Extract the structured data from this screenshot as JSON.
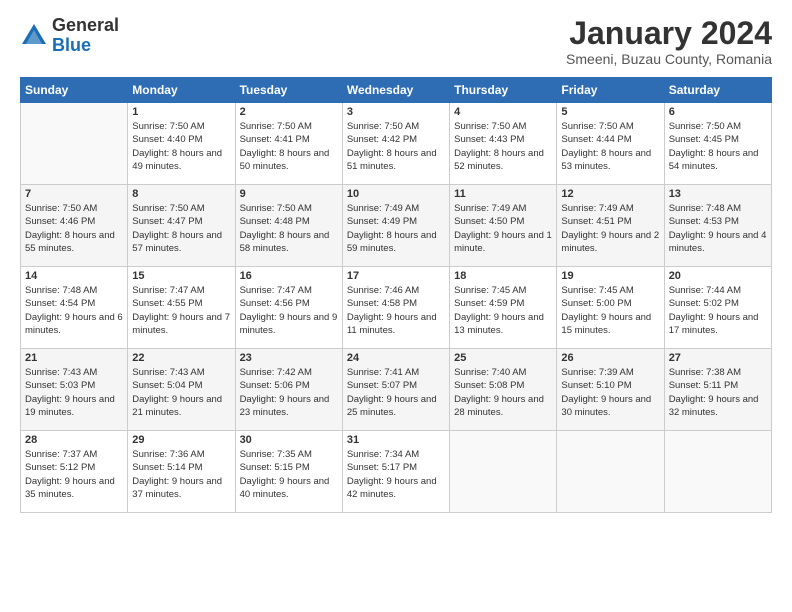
{
  "logo": {
    "general": "General",
    "blue": "Blue"
  },
  "title": "January 2024",
  "location": "Smeeni, Buzau County, Romania",
  "headers": [
    "Sunday",
    "Monday",
    "Tuesday",
    "Wednesday",
    "Thursday",
    "Friday",
    "Saturday"
  ],
  "weeks": [
    [
      {
        "day": "",
        "sunrise": "",
        "sunset": "",
        "daylight": ""
      },
      {
        "day": "1",
        "sunrise": "Sunrise: 7:50 AM",
        "sunset": "Sunset: 4:40 PM",
        "daylight": "Daylight: 8 hours and 49 minutes."
      },
      {
        "day": "2",
        "sunrise": "Sunrise: 7:50 AM",
        "sunset": "Sunset: 4:41 PM",
        "daylight": "Daylight: 8 hours and 50 minutes."
      },
      {
        "day": "3",
        "sunrise": "Sunrise: 7:50 AM",
        "sunset": "Sunset: 4:42 PM",
        "daylight": "Daylight: 8 hours and 51 minutes."
      },
      {
        "day": "4",
        "sunrise": "Sunrise: 7:50 AM",
        "sunset": "Sunset: 4:43 PM",
        "daylight": "Daylight: 8 hours and 52 minutes."
      },
      {
        "day": "5",
        "sunrise": "Sunrise: 7:50 AM",
        "sunset": "Sunset: 4:44 PM",
        "daylight": "Daylight: 8 hours and 53 minutes."
      },
      {
        "day": "6",
        "sunrise": "Sunrise: 7:50 AM",
        "sunset": "Sunset: 4:45 PM",
        "daylight": "Daylight: 8 hours and 54 minutes."
      }
    ],
    [
      {
        "day": "7",
        "sunrise": "Sunrise: 7:50 AM",
        "sunset": "Sunset: 4:46 PM",
        "daylight": "Daylight: 8 hours and 55 minutes."
      },
      {
        "day": "8",
        "sunrise": "Sunrise: 7:50 AM",
        "sunset": "Sunset: 4:47 PM",
        "daylight": "Daylight: 8 hours and 57 minutes."
      },
      {
        "day": "9",
        "sunrise": "Sunrise: 7:50 AM",
        "sunset": "Sunset: 4:48 PM",
        "daylight": "Daylight: 8 hours and 58 minutes."
      },
      {
        "day": "10",
        "sunrise": "Sunrise: 7:49 AM",
        "sunset": "Sunset: 4:49 PM",
        "daylight": "Daylight: 8 hours and 59 minutes."
      },
      {
        "day": "11",
        "sunrise": "Sunrise: 7:49 AM",
        "sunset": "Sunset: 4:50 PM",
        "daylight": "Daylight: 9 hours and 1 minute."
      },
      {
        "day": "12",
        "sunrise": "Sunrise: 7:49 AM",
        "sunset": "Sunset: 4:51 PM",
        "daylight": "Daylight: 9 hours and 2 minutes."
      },
      {
        "day": "13",
        "sunrise": "Sunrise: 7:48 AM",
        "sunset": "Sunset: 4:53 PM",
        "daylight": "Daylight: 9 hours and 4 minutes."
      }
    ],
    [
      {
        "day": "14",
        "sunrise": "Sunrise: 7:48 AM",
        "sunset": "Sunset: 4:54 PM",
        "daylight": "Daylight: 9 hours and 6 minutes."
      },
      {
        "day": "15",
        "sunrise": "Sunrise: 7:47 AM",
        "sunset": "Sunset: 4:55 PM",
        "daylight": "Daylight: 9 hours and 7 minutes."
      },
      {
        "day": "16",
        "sunrise": "Sunrise: 7:47 AM",
        "sunset": "Sunset: 4:56 PM",
        "daylight": "Daylight: 9 hours and 9 minutes."
      },
      {
        "day": "17",
        "sunrise": "Sunrise: 7:46 AM",
        "sunset": "Sunset: 4:58 PM",
        "daylight": "Daylight: 9 hours and 11 minutes."
      },
      {
        "day": "18",
        "sunrise": "Sunrise: 7:45 AM",
        "sunset": "Sunset: 4:59 PM",
        "daylight": "Daylight: 9 hours and 13 minutes."
      },
      {
        "day": "19",
        "sunrise": "Sunrise: 7:45 AM",
        "sunset": "Sunset: 5:00 PM",
        "daylight": "Daylight: 9 hours and 15 minutes."
      },
      {
        "day": "20",
        "sunrise": "Sunrise: 7:44 AM",
        "sunset": "Sunset: 5:02 PM",
        "daylight": "Daylight: 9 hours and 17 minutes."
      }
    ],
    [
      {
        "day": "21",
        "sunrise": "Sunrise: 7:43 AM",
        "sunset": "Sunset: 5:03 PM",
        "daylight": "Daylight: 9 hours and 19 minutes."
      },
      {
        "day": "22",
        "sunrise": "Sunrise: 7:43 AM",
        "sunset": "Sunset: 5:04 PM",
        "daylight": "Daylight: 9 hours and 21 minutes."
      },
      {
        "day": "23",
        "sunrise": "Sunrise: 7:42 AM",
        "sunset": "Sunset: 5:06 PM",
        "daylight": "Daylight: 9 hours and 23 minutes."
      },
      {
        "day": "24",
        "sunrise": "Sunrise: 7:41 AM",
        "sunset": "Sunset: 5:07 PM",
        "daylight": "Daylight: 9 hours and 25 minutes."
      },
      {
        "day": "25",
        "sunrise": "Sunrise: 7:40 AM",
        "sunset": "Sunset: 5:08 PM",
        "daylight": "Daylight: 9 hours and 28 minutes."
      },
      {
        "day": "26",
        "sunrise": "Sunrise: 7:39 AM",
        "sunset": "Sunset: 5:10 PM",
        "daylight": "Daylight: 9 hours and 30 minutes."
      },
      {
        "day": "27",
        "sunrise": "Sunrise: 7:38 AM",
        "sunset": "Sunset: 5:11 PM",
        "daylight": "Daylight: 9 hours and 32 minutes."
      }
    ],
    [
      {
        "day": "28",
        "sunrise": "Sunrise: 7:37 AM",
        "sunset": "Sunset: 5:12 PM",
        "daylight": "Daylight: 9 hours and 35 minutes."
      },
      {
        "day": "29",
        "sunrise": "Sunrise: 7:36 AM",
        "sunset": "Sunset: 5:14 PM",
        "daylight": "Daylight: 9 hours and 37 minutes."
      },
      {
        "day": "30",
        "sunrise": "Sunrise: 7:35 AM",
        "sunset": "Sunset: 5:15 PM",
        "daylight": "Daylight: 9 hours and 40 minutes."
      },
      {
        "day": "31",
        "sunrise": "Sunrise: 7:34 AM",
        "sunset": "Sunset: 5:17 PM",
        "daylight": "Daylight: 9 hours and 42 minutes."
      },
      {
        "day": "",
        "sunrise": "",
        "sunset": "",
        "daylight": ""
      },
      {
        "day": "",
        "sunrise": "",
        "sunset": "",
        "daylight": ""
      },
      {
        "day": "",
        "sunrise": "",
        "sunset": "",
        "daylight": ""
      }
    ]
  ]
}
